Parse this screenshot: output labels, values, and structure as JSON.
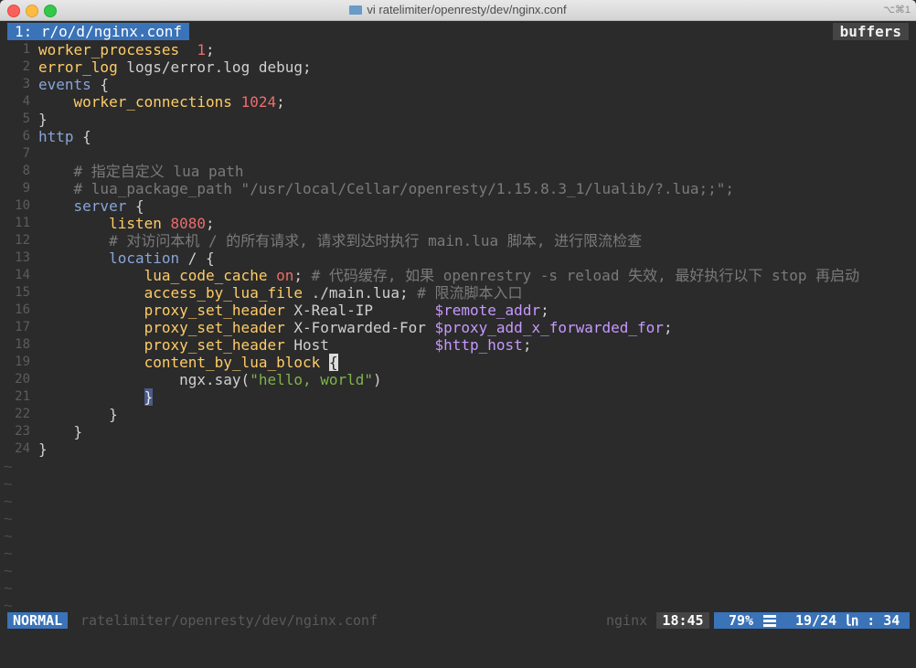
{
  "window": {
    "title": "vi ratelimiter/openresty/dev/nginx.conf",
    "shortcut": "⌥⌘1"
  },
  "tabline": {
    "active_tab": "1: r/o/d/nginx.conf",
    "buffers_label": "buffers"
  },
  "statusline": {
    "mode": "NORMAL",
    "file_path": "ratelimiter/openresty/dev/nginx.conf",
    "filetype": "nginx",
    "time": "18:45",
    "percent": "79%",
    "line_col": "19/24 ㏑ : 34"
  },
  "lines": [
    {
      "n": "1",
      "t": "worker_processes  1;"
    },
    {
      "n": "2",
      "t": "error_log logs/error.log debug;"
    },
    {
      "n": "3",
      "t": "events {"
    },
    {
      "n": "4",
      "t": "    worker_connections 1024;"
    },
    {
      "n": "5",
      "t": "}"
    },
    {
      "n": "6",
      "t": "http {"
    },
    {
      "n": "7",
      "t": ""
    },
    {
      "n": "8",
      "t": "    # 指定自定义 lua path"
    },
    {
      "n": "9",
      "t": "    # lua_package_path \"/usr/local/Cellar/openresty/1.15.8.3_1/lualib/?.lua;;\";"
    },
    {
      "n": "10",
      "t": "    server {"
    },
    {
      "n": "11",
      "t": "        listen 8080;"
    },
    {
      "n": "12",
      "t": "        # 对访问本机 / 的所有请求, 请求到达时执行 main.lua 脚本, 进行限流检查"
    },
    {
      "n": "13",
      "t": "        location / {"
    },
    {
      "n": "14",
      "t": "            lua_code_cache on; # 代码缓存, 如果 openrestry -s reload 失效, 最好执行以下 stop 再启动"
    },
    {
      "n": "15",
      "t": "            access_by_lua_file ./main.lua; # 限流脚本入口"
    },
    {
      "n": "16",
      "t": "            proxy_set_header X-Real-IP       $remote_addr;"
    },
    {
      "n": "17",
      "t": "            proxy_set_header X-Forwarded-For $proxy_add_x_forwarded_for;"
    },
    {
      "n": "18",
      "t": "            proxy_set_header Host            $http_host;"
    },
    {
      "n": "19",
      "t": "            content_by_lua_block {"
    },
    {
      "n": "20",
      "t": "                ngx.say(\"hello, world\")"
    },
    {
      "n": "21",
      "t": "            }"
    },
    {
      "n": "22",
      "t": "        }"
    },
    {
      "n": "23",
      "t": "    }"
    },
    {
      "n": "24",
      "t": "}"
    }
  ],
  "tilde_char": "~",
  "colors": {
    "accent": "#3a73b8",
    "keyword": "#ffcc66",
    "block": "#88a4d8",
    "number": "#ef6b6b",
    "string": "#7fb34c",
    "variable": "#c799ff",
    "comment": "#7a7a7a"
  }
}
